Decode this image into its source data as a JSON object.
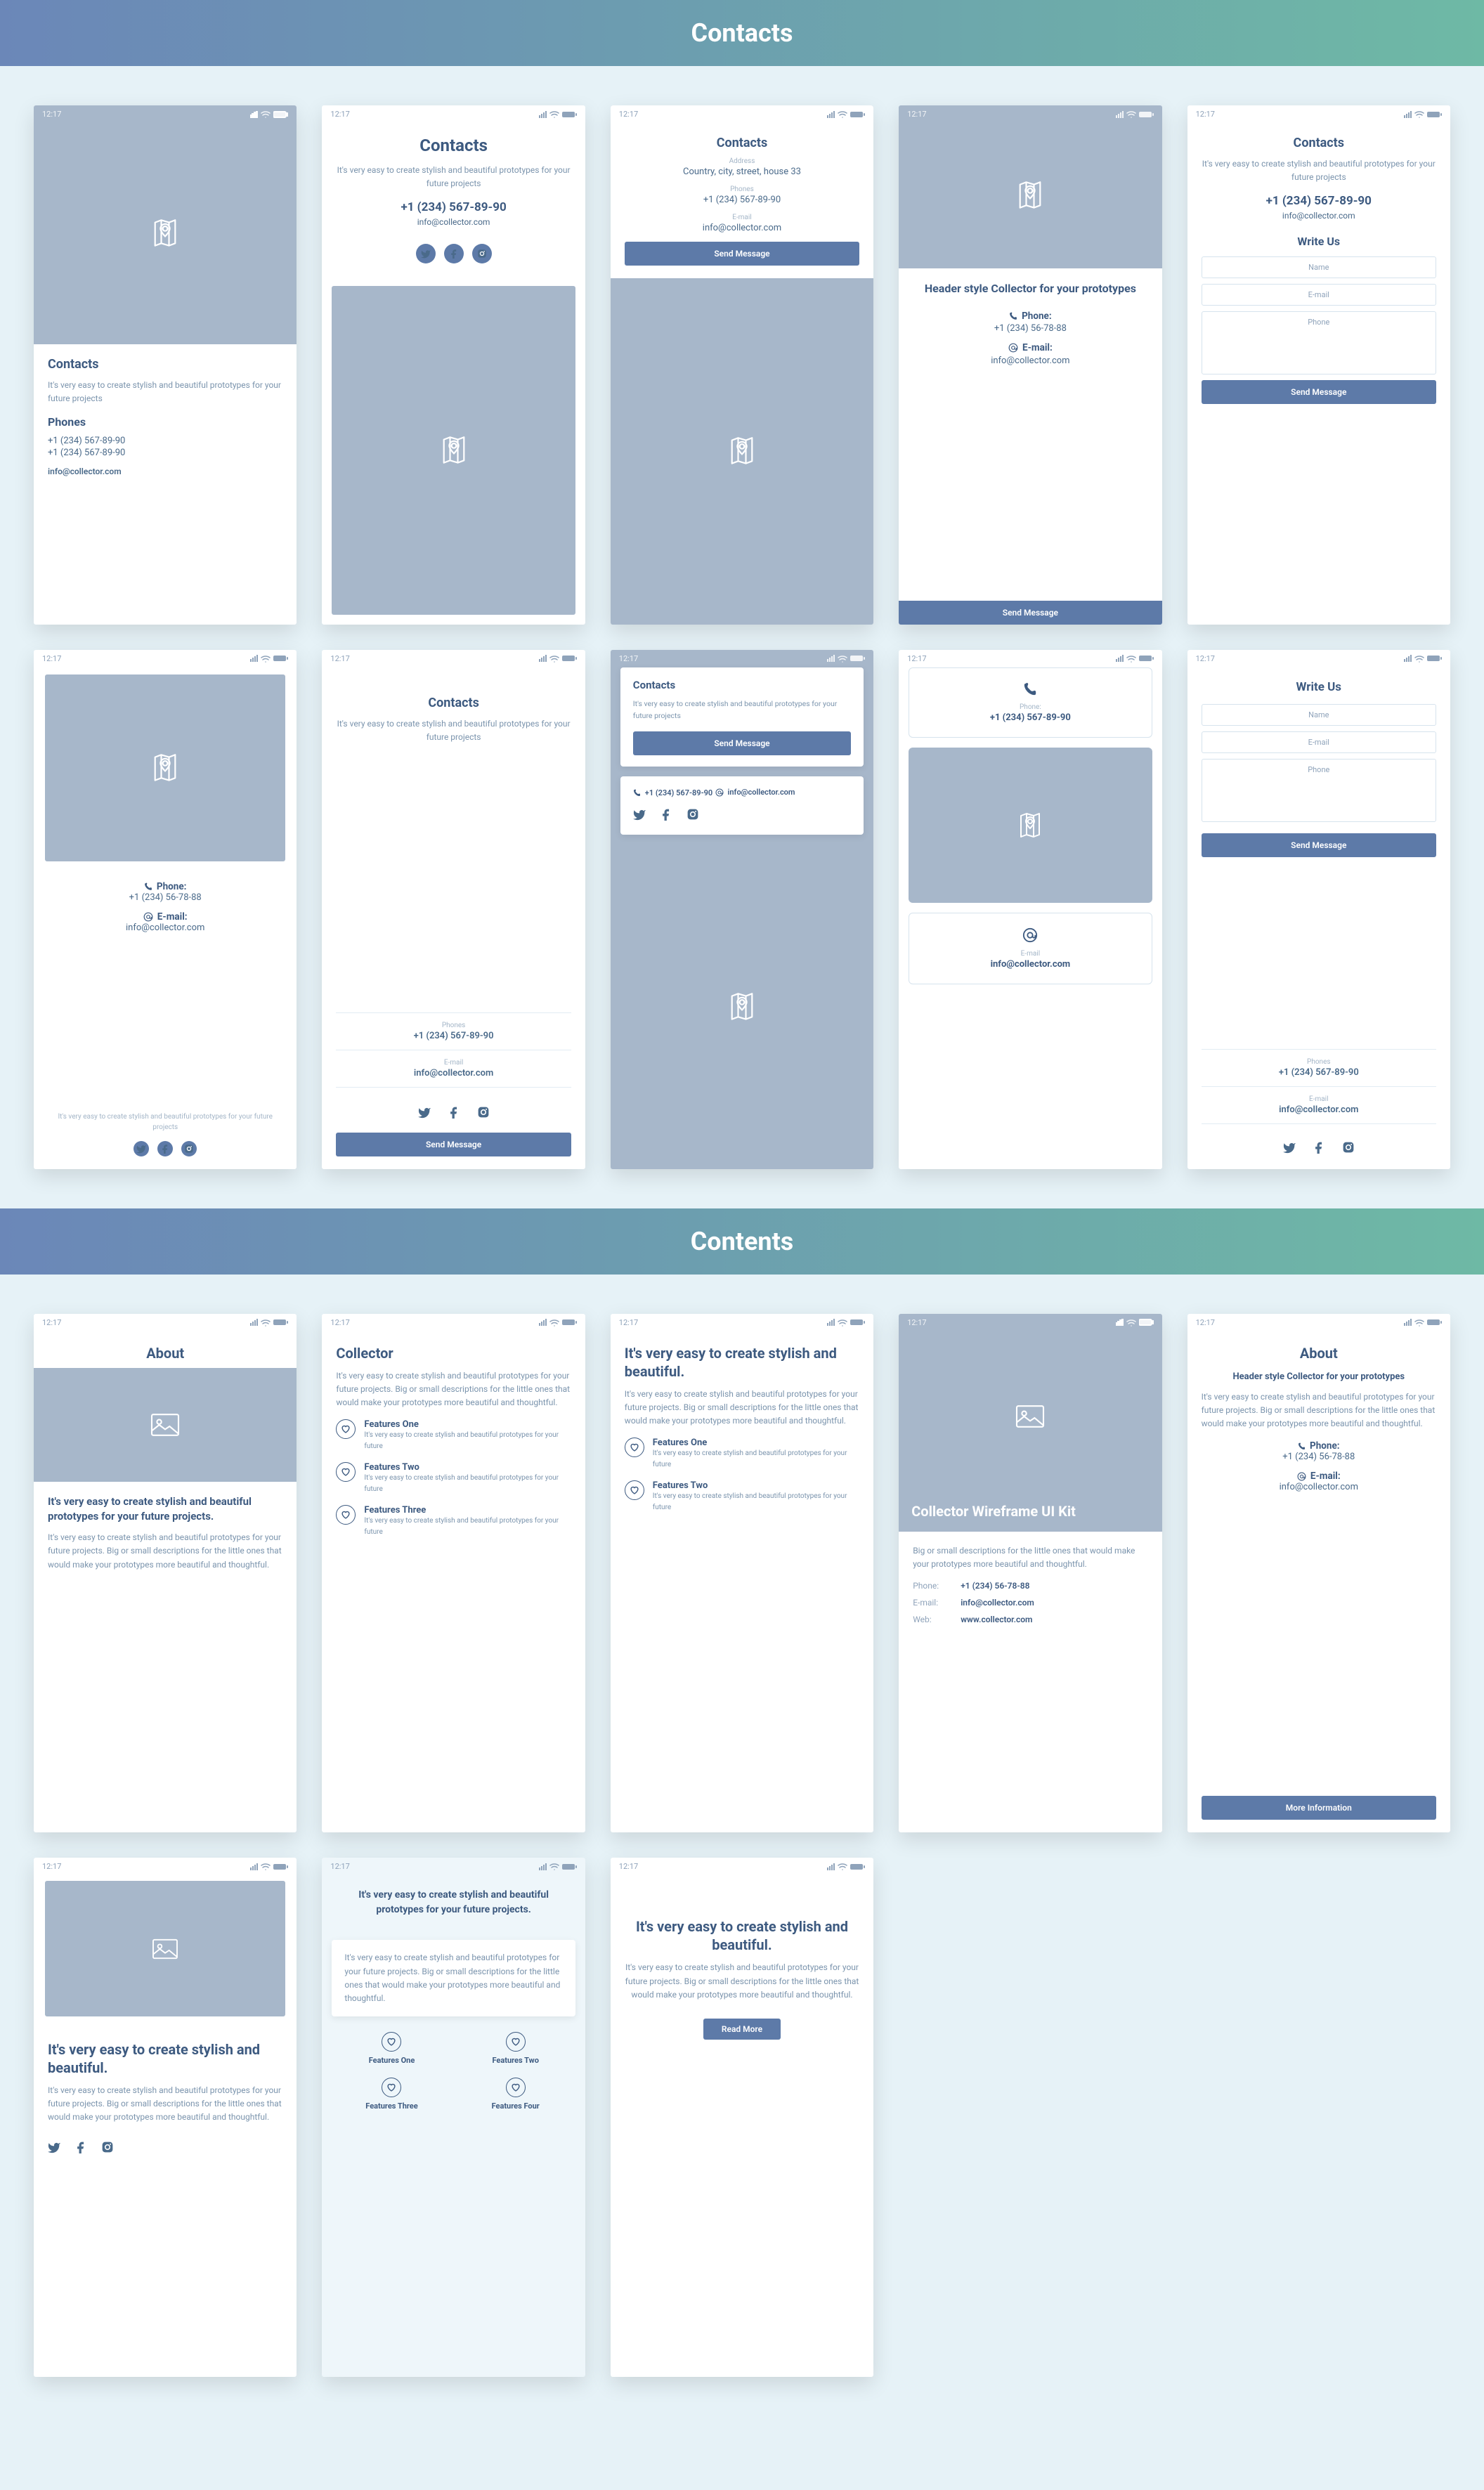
{
  "sections": {
    "contacts": "Contacts",
    "contents": "Contents"
  },
  "status": {
    "time": "12:17"
  },
  "common": {
    "contacts_title": "Contacts",
    "about_title": "About",
    "collector_title": "Collector",
    "write_us": "Write Us",
    "intro": "It's very easy to create stylish and beautiful prototypes for your future projects",
    "phones_label": "Phones",
    "phone_label": "Phone:",
    "email_label": "E-mail:",
    "email_label_plain": "E-mail",
    "address_label": "Address",
    "web_label": "Web:",
    "phone1": "+1 (234) 567-89-90",
    "phone2": "+1 (234) 567-89-90",
    "phone_short": "+1 (234) 56-78-88",
    "email": "info@collector.com",
    "web": "www.collector.com",
    "address": "Country, city, street, house 33",
    "send_message": "Send Message",
    "more_info": "More Information",
    "read_more": "Read More",
    "header_style": "Header style Collector for your prototypes",
    "wireframe_kit": "Collector Wireframe UI Kit",
    "headline_easy": "It's very easy to create stylish and beautiful.",
    "headline_proj": "It's very easy to create stylish and beautiful prototypes for your future projects.",
    "long_desc": "It's very easy to create stylish and beautiful prototypes for your future projects. Big or small descriptions for the little ones that would make your prototypes more beautiful and thoughtful.",
    "short_desc": "Big or small descriptions for the little ones that would make your prototypes more beautiful and thoughtful.",
    "feat_sub": "It's very easy to create stylish and beautiful prototypes for your future",
    "form": {
      "name": "Name",
      "email": "E-mail",
      "phone": "Phone"
    },
    "features": {
      "one": "Features One",
      "two": "Features Two",
      "three": "Features Three",
      "four": "Features Four"
    }
  }
}
